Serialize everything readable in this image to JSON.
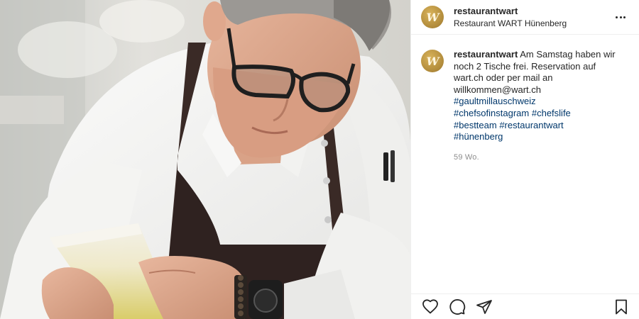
{
  "header": {
    "username": "restaurantwart",
    "location": "Restaurant WART Hünenberg",
    "avatar_glyph": "W",
    "more_icon": "more-horizontal-icon"
  },
  "caption": {
    "username": "restaurantwart",
    "text_lines": [
      "Am Samstag haben wir",
      "noch 2 Tische frei. Reservation auf",
      "wart.ch oder per mail an",
      "willkommen@wart.ch"
    ],
    "hashtags": [
      "#gaultmillauschweiz",
      "#chefsofinstagram",
      "#chefslife",
      "#bestteam",
      "#restaurantwart",
      "#hünenberg"
    ],
    "timestamp": "59 Wo."
  },
  "actions": {
    "like_icon": "heart-icon",
    "comment_icon": "comment-icon",
    "share_icon": "share-icon",
    "save_icon": "bookmark-icon"
  },
  "colors": {
    "link": "#00376b",
    "text": "#262626",
    "muted": "#8e8e8e",
    "avatar_gold": "#b08a3a"
  }
}
